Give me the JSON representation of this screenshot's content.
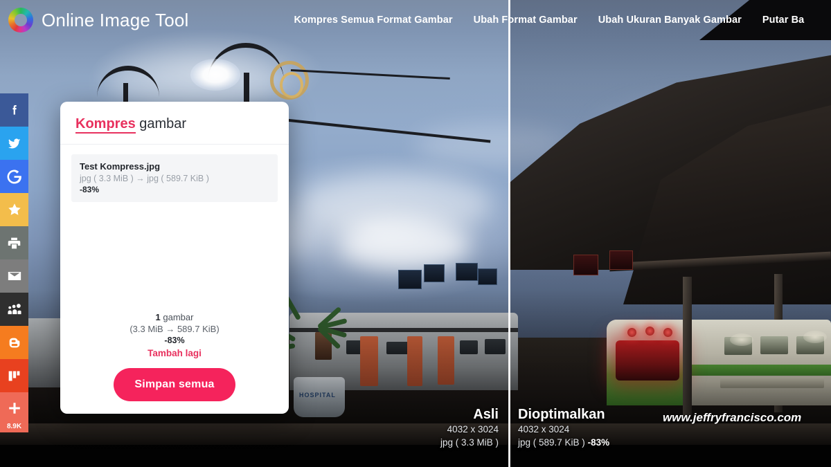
{
  "brand": {
    "name": "Online Image Tool",
    "logo_icon": "rainbow-ring-logo"
  },
  "nav": {
    "links": [
      {
        "label": "Kompres Semua Format Gambar"
      },
      {
        "label": "Ubah Format Gambar"
      },
      {
        "label": "Ubah Ukuran Banyak Gambar"
      },
      {
        "label": "Putar Ba"
      }
    ]
  },
  "social_sidebar": {
    "items": [
      {
        "name": "facebook",
        "icon": "facebook-icon",
        "color": "#3b5998",
        "label": "Facebook"
      },
      {
        "name": "twitter",
        "icon": "twitter-icon",
        "color": "#2aa3ef",
        "label": "Twitter"
      },
      {
        "name": "google",
        "icon": "google-icon",
        "color": "#3b72f0",
        "label": "Google"
      },
      {
        "name": "favorites",
        "icon": "star-icon",
        "color": "#f3bd4b",
        "label": "Favorites"
      },
      {
        "name": "print",
        "icon": "printer-icon",
        "color": "#6d7471",
        "label": "Print"
      },
      {
        "name": "email",
        "icon": "envelope-icon",
        "color": "#7d7d7d",
        "label": "Email"
      },
      {
        "name": "myspace",
        "icon": "myspace-icon",
        "color": "#2f2f2f",
        "label": "MySpace"
      },
      {
        "name": "blogger",
        "icon": "blogger-icon",
        "color": "#f57c1f",
        "label": "Blogger"
      },
      {
        "name": "mix",
        "icon": "mix-icon",
        "color": "#e8411f",
        "label": "Mix"
      },
      {
        "name": "share-more",
        "icon": "plus-icon",
        "color": "#ef6a57",
        "label": "Share",
        "count": "8.9K"
      }
    ]
  },
  "dialog": {
    "title_highlight": "Kompres",
    "title_rest": " gambar",
    "file": {
      "name": "Test Kompress.jpg",
      "conversion": "jpg ( 3.3 MiB ) → jpg ( 589.7 KiB )",
      "percent": "-83%"
    },
    "summary": {
      "count": "1",
      "count_unit": " gambar",
      "sizes": "(3.3 MiB → 589.7 KiB)",
      "percent": "-83%",
      "add_more_label": "Tambah lagi"
    },
    "save_button_label": "Simpan semua",
    "accent_color": "#f5235c"
  },
  "comparison": {
    "original": {
      "title": "Asli",
      "dimensions": "4032 x 3024",
      "size": "jpg ( 3.3 MiB )"
    },
    "optimized": {
      "title": "Dioptimalkan",
      "dimensions": "4032 x 3024",
      "size": "jpg ( 589.7 KiB )",
      "percent": "-83%"
    }
  },
  "watermark": {
    "text": "www.jeffryfrancisco.com"
  }
}
